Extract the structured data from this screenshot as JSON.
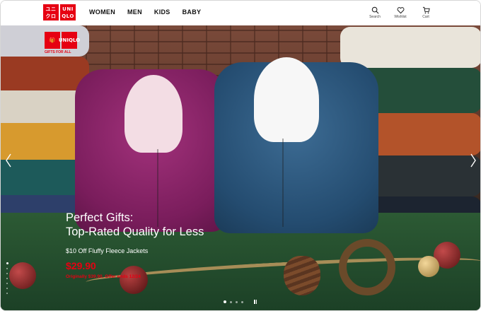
{
  "header": {
    "logo": {
      "top": "UNI",
      "bottom": "QLO",
      "jp_top": "ユニ",
      "jp_bottom": "クロ"
    },
    "nav": [
      "WOMEN",
      "MEN",
      "KIDS",
      "BABY"
    ],
    "utils": [
      {
        "label": "Search",
        "icon": "search-icon"
      },
      {
        "label": "Wishlist",
        "icon": "heart-icon"
      },
      {
        "label": "Cart",
        "icon": "cart-icon"
      }
    ]
  },
  "hero": {
    "brand_tag": "GIFTS FOR ALL",
    "headline_line1": "Perfect Gifts:",
    "headline_line2": "Top-Rated Quality for Less",
    "offer": "$10 Off Fluffy Fleece Jackets",
    "price": "$29.90",
    "original": "Originally $39.90. Offer ends 12/24",
    "carousel_pages": 4,
    "carousel_active": 0
  },
  "colors": {
    "brand_red": "#e60012",
    "accent_green": "#1f3a25"
  }
}
